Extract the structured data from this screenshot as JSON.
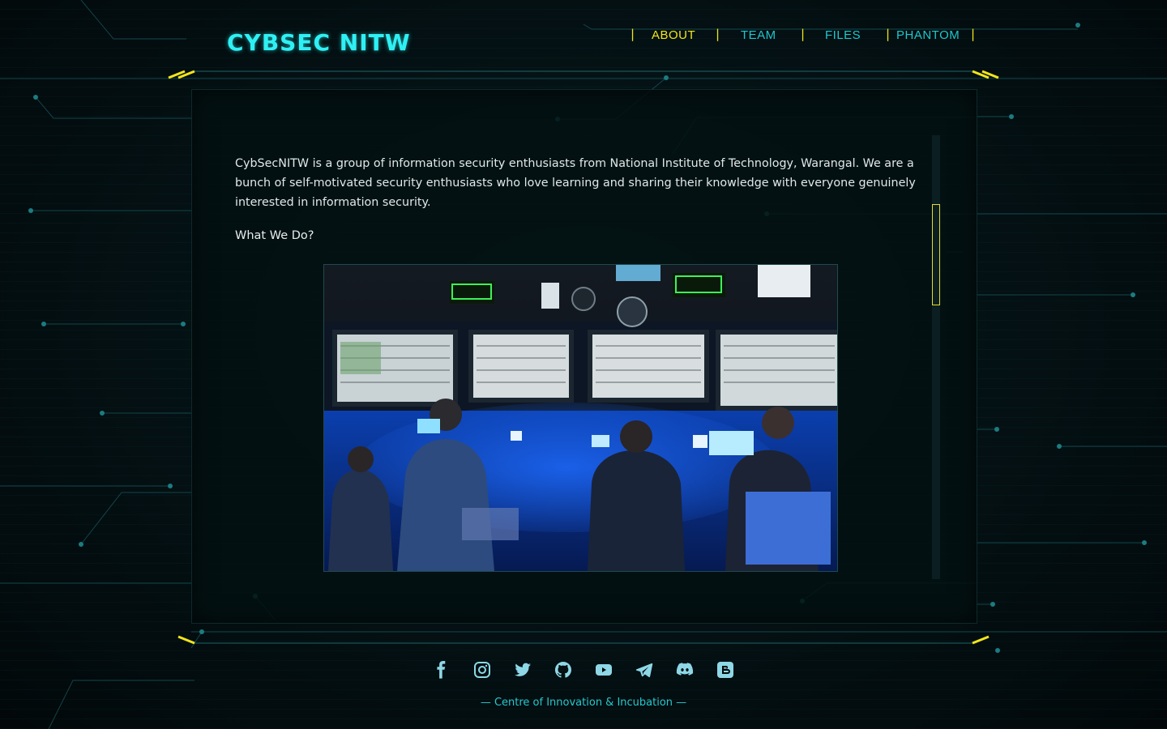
{
  "header": {
    "logo": "CYBSEC NITW"
  },
  "nav": {
    "items": [
      {
        "label": "ABOUT",
        "active": true
      },
      {
        "label": "TEAM",
        "active": false
      },
      {
        "label": "FILES",
        "active": false
      },
      {
        "label": "PHANTOM",
        "active": false
      }
    ],
    "separator": "|"
  },
  "main": {
    "about_text": "CybSecNITW is a group of information security enthusiasts from National Institute of Technology, Warangal. We are a bunch of self-motivated security enthusiasts who love learning and sharing their knowledge with everyone genuinely interested in information security.",
    "subheading": "What We Do?",
    "scroll_position": 0.2
  },
  "social": [
    "facebook-icon",
    "instagram-icon",
    "twitter-icon",
    "github-icon",
    "youtube-icon",
    "telegram-icon",
    "discord-icon",
    "blogger-icon"
  ],
  "footer": {
    "text": "— Centre of Innovation & Incubation —"
  },
  "colors": {
    "accent_cyan": "#2ef0f4",
    "accent_yellow": "#f1e51b",
    "nav_cyan": "#1fc6cd",
    "background": "#02090b"
  }
}
